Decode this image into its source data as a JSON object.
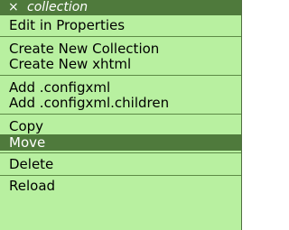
{
  "menu": {
    "header": {
      "close_glyph": "×",
      "title": "collection"
    },
    "items": [
      "Edit in Properties",
      "Create New Collection",
      "Create New xhtml",
      "Add .configxml",
      "Add .configxml.children",
      "Copy",
      "Move",
      "Delete",
      "Reload"
    ],
    "selected_item": "Move",
    "colors": {
      "background": "#b8f0a0",
      "header": "#4f7a3c",
      "selected": "#4f7a3c",
      "separator": "#5d8a46"
    }
  }
}
